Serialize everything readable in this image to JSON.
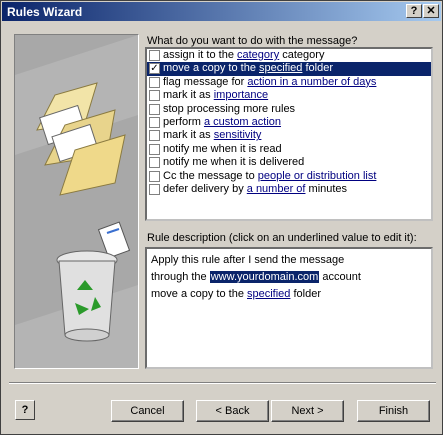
{
  "window": {
    "title": "Rules Wizard",
    "help_glyph": "?",
    "close_glyph": "✕"
  },
  "question": "What do you want to do with the message?",
  "conditions": [
    {
      "checked": false,
      "selected": false,
      "pre": "assign it to the ",
      "link": "category",
      "post": " category"
    },
    {
      "checked": true,
      "selected": true,
      "pre": "move a copy to the ",
      "link": "specified",
      "post": " folder"
    },
    {
      "checked": false,
      "selected": false,
      "pre": "flag message for ",
      "link": "action in a number of days",
      "post": ""
    },
    {
      "checked": false,
      "selected": false,
      "pre": "mark it as ",
      "link": "importance",
      "post": ""
    },
    {
      "checked": false,
      "selected": false,
      "pre": "stop processing more rules",
      "link": "",
      "post": ""
    },
    {
      "checked": false,
      "selected": false,
      "pre": "perform ",
      "link": "a custom action",
      "post": ""
    },
    {
      "checked": false,
      "selected": false,
      "pre": "mark it as ",
      "link": "sensitivity",
      "post": ""
    },
    {
      "checked": false,
      "selected": false,
      "pre": "notify me when it is read",
      "link": "",
      "post": ""
    },
    {
      "checked": false,
      "selected": false,
      "pre": "notify me when it is delivered",
      "link": "",
      "post": ""
    },
    {
      "checked": false,
      "selected": false,
      "pre": "Cc the message to ",
      "link": "people or distribution list",
      "post": ""
    },
    {
      "checked": false,
      "selected": false,
      "pre": "defer delivery by ",
      "link": "a number of",
      "post": " minutes"
    }
  ],
  "description_label": "Rule description (click on an underlined value to edit it):",
  "description": {
    "line1": "Apply this rule after I send the message",
    "line2_pre": "through the ",
    "line2_hl": "www.yourdomain.com",
    "line2_post": " account",
    "line3_pre": "move a copy to the ",
    "line3_link": "specified",
    "line3_post": " folder"
  },
  "buttons": {
    "cancel": "Cancel",
    "back": "< Back",
    "next": "Next >",
    "finish": "Finish"
  },
  "help_button_glyph": "?"
}
